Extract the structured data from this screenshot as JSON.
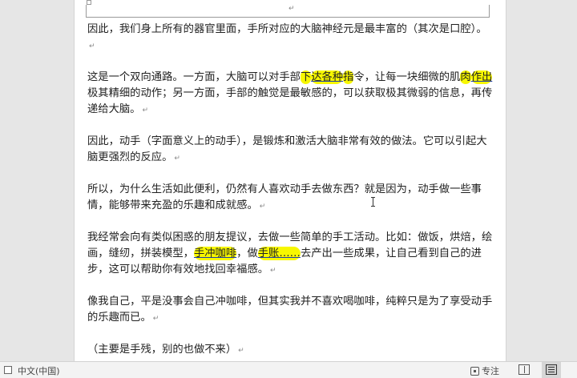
{
  "document": {
    "top_paragraph_mark": "↵",
    "paragraph_mark": "↵",
    "paragraphs": [
      {
        "segments": [
          {
            "text": "因此，我们身上所有的器官里面，手所对应的大脑神经元是最丰富的（其次是口腔）。"
          }
        ]
      },
      {
        "segments": [
          {
            "text": "这是一个双向通路。一方面，大脑可以对手部"
          },
          {
            "text": "下",
            "hl": true
          },
          {
            "text": "达各种",
            "hl": true,
            "ul": true
          },
          {
            "text": "指",
            "hl": true
          },
          {
            "text": "令，让每一块细微的肌"
          },
          {
            "text": "肉",
            "hl": true
          },
          {
            "text": "作出",
            "hl": true,
            "ul": true
          },
          {
            "text": "极其精细的动作；另一方面，手部的触觉是最敏感的，可以获取极其微弱的信息，再传递给大脑。"
          }
        ]
      },
      {
        "segments": [
          {
            "text": "因此，动手（字面意义上的动手），是锻炼和激活大脑非常有效的做法。它可以引起大脑更强烈的反应。"
          }
        ]
      },
      {
        "segments": [
          {
            "text": "所以，为什么生活如此便利，仍然有人喜欢动手去做东西？就是因为，动手做一些事情，能够带来充盈的乐趣和成就感。"
          }
        ]
      },
      {
        "segments": [
          {
            "text": "我经常会向有类似困惑的朋友提议，去做一些简单的手工活动。比如：做饭，烘焙，绘画，缝纫，拼装模型，"
          },
          {
            "text": "手冲咖啡",
            "hl": true,
            "ul": true
          },
          {
            "text": "，做"
          },
          {
            "text": "手账……",
            "hl": true,
            "ul": true
          },
          {
            "text": "去产出一些成果，让自己看到自己的进步，这可以帮助你有效地找回幸福感。"
          }
        ]
      },
      {
        "segments": [
          {
            "text": "像我自己，平是没事会自己冲咖啡，但其实我并不喜欢喝咖啡，纯粹只是为了享受动手的乐趣而已。"
          }
        ]
      },
      {
        "segments": [
          {
            "text": "（主要是手残，别的也做不来）"
          }
        ]
      }
    ]
  },
  "statusbar": {
    "language": "中文(中国)",
    "focus_label": "专注"
  },
  "colors": {
    "highlight": "#f7f700",
    "underline": "#1f3fa8"
  }
}
